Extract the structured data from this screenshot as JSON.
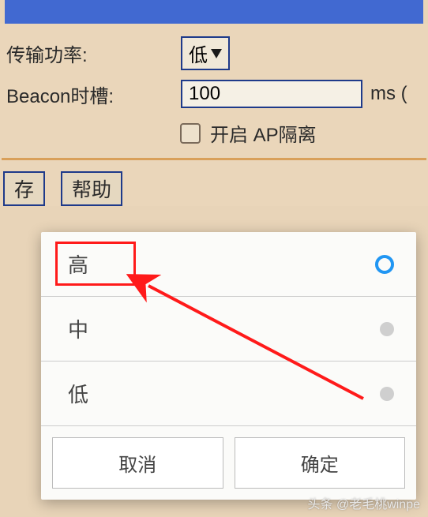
{
  "topbar": {},
  "settings": {
    "tx_power_label": "传输功率:",
    "tx_power_value": "低",
    "beacon_label": "Beacon时槽:",
    "beacon_value": "100",
    "beacon_unit": "ms (",
    "ap_isolate_label": "开启 AP隔离"
  },
  "buttons": {
    "save": "存",
    "help": "帮助"
  },
  "popup": {
    "options": {
      "high": "高",
      "medium": "中",
      "low": "低"
    },
    "cancel": "取消",
    "confirm": "确定"
  },
  "watermark": "头条 @老毛桃winpe"
}
